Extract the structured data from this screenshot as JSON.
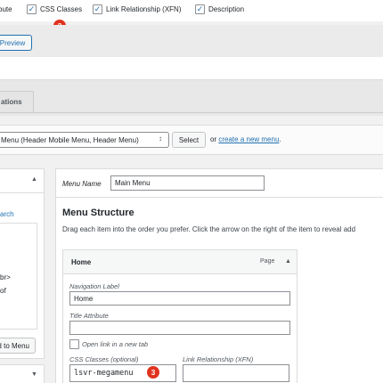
{
  "screen_options": {
    "items": [
      {
        "label": "bute",
        "checked": false
      },
      {
        "label": "CSS Classes",
        "checked": true
      },
      {
        "label": "Link Relationship (XFN)",
        "checked": true
      },
      {
        "label": "Description",
        "checked": true
      }
    ]
  },
  "badges": {
    "step2": "2",
    "step3": "3"
  },
  "preview_button": "Preview",
  "tabs": {
    "active": "ations"
  },
  "menu_select": {
    "selected": "Menu (Header Mobile Menu, Header Menu)",
    "select_button": "Select",
    "or_text": "or",
    "create_link": "create a new menu",
    "period": "."
  },
  "left_panel": {
    "search_link": "arch",
    "text1": "br>",
    "text2": "of",
    "add_button": "d to Menu"
  },
  "menu_name": {
    "label": "Menu Name",
    "value": "Main Menu"
  },
  "menu_structure": {
    "title": "Menu Structure",
    "instructions": "Drag each item into the order you prefer. Click the arrow on the right of the item to reveal add"
  },
  "menu_item": {
    "title": "Home",
    "type": "Page",
    "navigation_label": {
      "label": "Navigation Label",
      "value": "Home"
    },
    "title_attribute": {
      "label": "Title Attribute",
      "value": ""
    },
    "open_new_tab": {
      "label": "Open link in a new tab",
      "checked": false
    },
    "css_classes": {
      "label": "CSS Classes (optional)",
      "value": "lsvr-megamenu"
    },
    "xfn": {
      "label": "Link Relationship (XFN)",
      "value": ""
    }
  },
  "colors": {
    "accent": "#2271b1",
    "badge": "#e0321e"
  }
}
